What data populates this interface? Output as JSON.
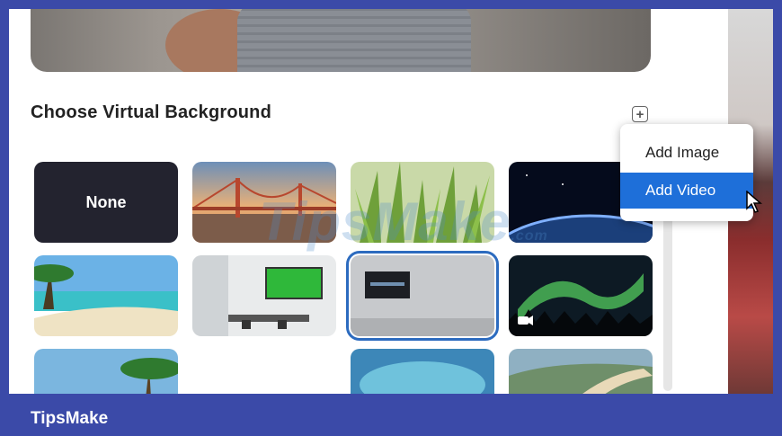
{
  "section": {
    "title": "Choose Virtual Background",
    "add_symbol": "+"
  },
  "tiles": {
    "none_label": "None"
  },
  "menu": {
    "items": [
      "Add Image",
      "Add Video"
    ],
    "highlighted": "Add Video"
  },
  "watermark": {
    "text": "TipsMake",
    "suffix": ".com"
  },
  "footer": {
    "brand": "TipsMake"
  },
  "colors": {
    "frame_border": "#3b4aa8",
    "menu_highlight": "#1e6fd9",
    "selected_outline": "#2c6bbf",
    "none_tile": "#23232f"
  }
}
